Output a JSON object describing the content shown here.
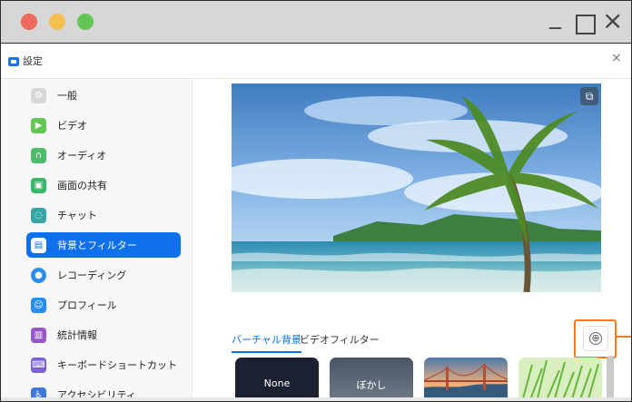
{
  "window": {
    "title": "設定",
    "minimize": "_",
    "close": "×"
  },
  "sidebar": {
    "items": [
      {
        "label": "一般",
        "icon": "gear-icon",
        "color": "#d9d9d9"
      },
      {
        "label": "ビデオ",
        "icon": "video-camera-icon",
        "color": "#62c554"
      },
      {
        "label": "オーディオ",
        "icon": "headphones-icon",
        "color": "#4cbc6c"
      },
      {
        "label": "画面の共有",
        "icon": "screen-share-icon",
        "color": "#39b86a"
      },
      {
        "label": "チャット",
        "icon": "chat-bubble-icon",
        "color": "#34a7a4"
      },
      {
        "label": "背景とフィルター",
        "icon": "background-filter-icon",
        "color": "#0e71eb",
        "active": true
      },
      {
        "label": "レコーディング",
        "icon": "record-icon",
        "color": "#2a8ef0"
      },
      {
        "label": "プロフィール",
        "icon": "profile-icon",
        "color": "#2a8ef0"
      },
      {
        "label": "統計情報",
        "icon": "statistics-icon",
        "color": "#9658c6"
      },
      {
        "label": "キーボードショートカット",
        "icon": "keyboard-icon",
        "color": "#7d61d2"
      },
      {
        "label": "アクセシビリティ",
        "icon": "accessibility-icon",
        "color": "#3f78d8"
      }
    ]
  },
  "main": {
    "tabs": [
      {
        "label": "バーチャル背景",
        "active": true
      },
      {
        "label": "ビデオフィルター",
        "active": false
      }
    ],
    "add_button": "⊕",
    "thumbnails": [
      {
        "label": "None"
      },
      {
        "label": "ぼかし"
      },
      {
        "label": ""
      },
      {
        "label": ""
      }
    ]
  },
  "colors": {
    "accent": "#0e71eb",
    "callout": "#f47b20"
  }
}
